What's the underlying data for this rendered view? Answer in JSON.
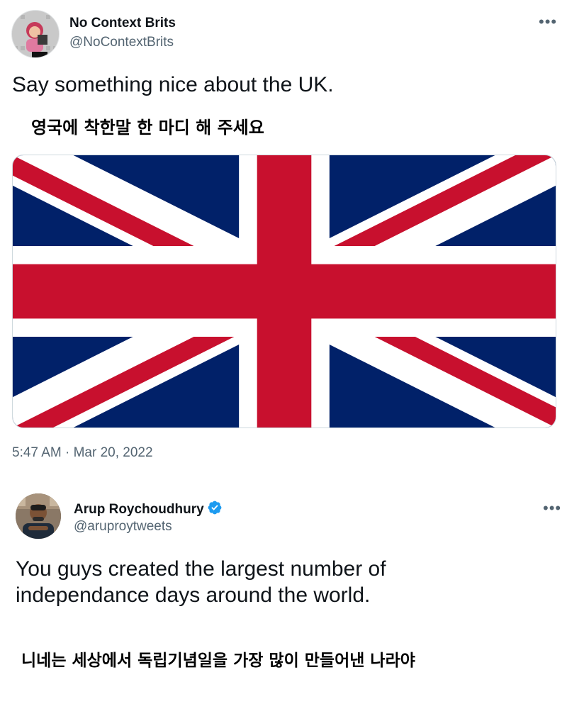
{
  "tweet1": {
    "author_name": "No Context Brits",
    "author_handle": "@NoContextBrits",
    "text": "Say something nice about the UK.",
    "annotation": "영국에 착한말 한 마디 해 주세요",
    "timestamp": "5:47 AM · Mar 20, 2022",
    "more_icon": "more-horizontal-icon"
  },
  "tweet2": {
    "author_name": "Arup Roychoudhury",
    "author_handle": "@aruproytweets",
    "verified": true,
    "text_line1": "You guys created the largest number of",
    "text_line2": "independance days around the world.",
    "annotation": "니네는 세상에서 독립기념일을 가장 많이 만들어낸 나라야",
    "more_icon": "more-horizontal-icon"
  },
  "colors": {
    "flag_blue": "#012169",
    "flag_red": "#c8102e",
    "verified_blue": "#1d9bf0",
    "handle_gray": "#536471"
  }
}
